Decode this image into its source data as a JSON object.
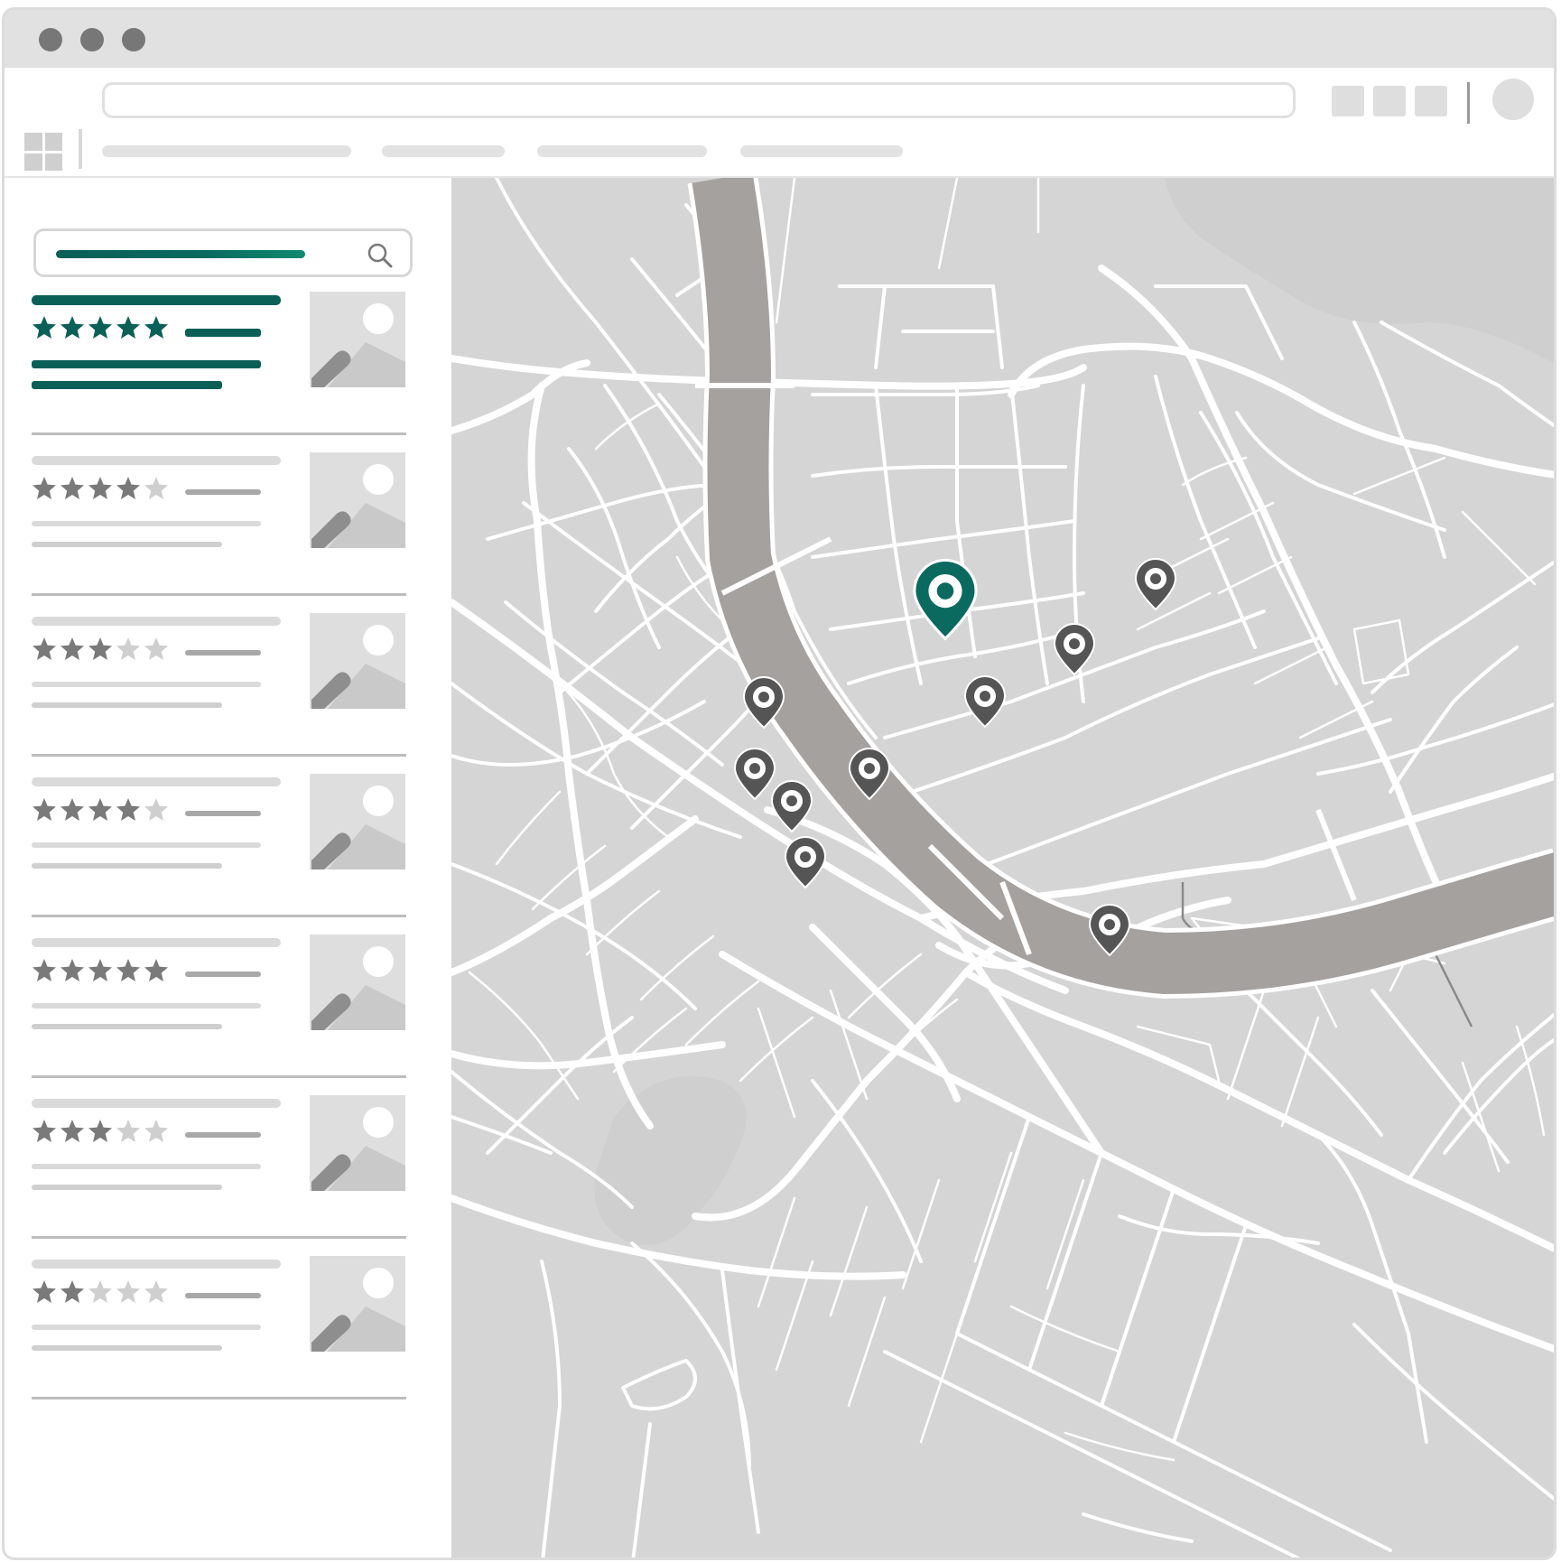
{
  "browser": {
    "window_controls": [
      "close-dot",
      "minimize-dot",
      "maximize-dot"
    ],
    "address_bar": "",
    "toolbar_icons": [
      "toolbar-square-icon",
      "toolbar-square-icon",
      "toolbar-square-icon",
      "avatar"
    ],
    "nav_items": [
      "",
      "",
      "",
      ""
    ]
  },
  "sidebar": {
    "search": {
      "query": "",
      "icon": "search-icon"
    },
    "results": [
      {
        "title": "",
        "rating": 5,
        "rating_text": "",
        "line1": "",
        "line2": "",
        "active": true,
        "thumbnail": "image-placeholder-icon"
      },
      {
        "title": "",
        "rating": 4,
        "rating_text": "",
        "line1": "",
        "line2": "",
        "active": false,
        "thumbnail": "image-placeholder-icon"
      },
      {
        "title": "",
        "rating": 3,
        "rating_text": "",
        "line1": "",
        "line2": "",
        "active": false,
        "thumbnail": "image-placeholder-icon"
      },
      {
        "title": "",
        "rating": 4,
        "rating_text": "",
        "line1": "",
        "line2": "",
        "active": false,
        "thumbnail": "image-placeholder-icon"
      },
      {
        "title": "",
        "rating": 5,
        "rating_text": "",
        "line1": "",
        "line2": "",
        "active": false,
        "thumbnail": "image-placeholder-icon"
      },
      {
        "title": "",
        "rating": 3,
        "rating_text": "",
        "line1": "",
        "line2": "",
        "active": false,
        "thumbnail": "image-placeholder-icon"
      },
      {
        "title": "",
        "rating": 2,
        "rating_text": "",
        "line1": "",
        "line2": "",
        "active": false,
        "thumbnail": "image-placeholder-icon"
      }
    ]
  },
  "map": {
    "markers_count": 10,
    "selected_marker": "map-pin-selected-icon",
    "marker_icon": "map-pin-icon"
  },
  "colors": {
    "accent": "#0a6a60",
    "accent_dark": "#0a5f57",
    "star_active": "#0a5f57",
    "star_gray": "#7a7a7a",
    "star_empty": "#cfcfcf",
    "map_land": "#d5d5d5",
    "river": "#a5a19f",
    "roads": "#ffffff",
    "pin": "#555555"
  }
}
